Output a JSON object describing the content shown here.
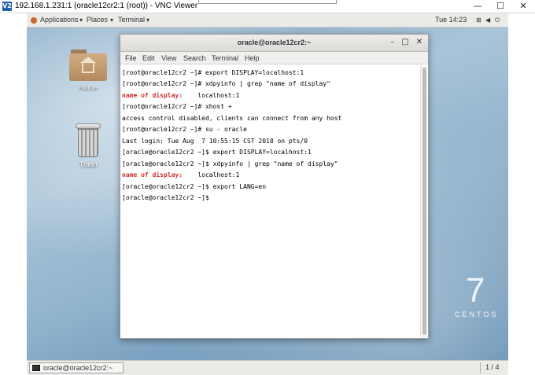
{
  "vnc": {
    "logo": "V2",
    "title": "192.168.1.231:1 (oracle12cr2:1 (root)) - VNC Viewer",
    "controls": {
      "minimize": "—",
      "maximize": "☐",
      "close": "✕"
    }
  },
  "topbar": {
    "applications": "Applications",
    "places": "Places",
    "terminal": "Terminal",
    "clock": "Tue 14:23"
  },
  "desktop": {
    "home_label": "Home",
    "trash_label": "Trash",
    "watermark_number": "7",
    "watermark_word": "CENTOS"
  },
  "terminal": {
    "title": "oracle@oracle12cr2:~",
    "controls": {
      "minimize": "–",
      "maximize": "□",
      "close": "✕"
    },
    "menu": [
      "File",
      "Edit",
      "View",
      "Search",
      "Terminal",
      "Help"
    ],
    "lines": [
      {
        "text": "[root@oracle12cr2 ~]# export DISPLAY=localhost:1"
      },
      {
        "text": "[root@oracle12cr2 ~]# xdpyinfo | grep \"name of display\""
      },
      {
        "red": "name of display:",
        "text": "    localhost:1"
      },
      {
        "text": "[root@oracle12cr2 ~]# xhost +"
      },
      {
        "text": "access control disabled, clients can connect from any host"
      },
      {
        "text": "[root@oracle12cr2 ~]# su - oracle"
      },
      {
        "text": "Last login: Tue Aug  7 10:55:15 CST 2018 on pts/0"
      },
      {
        "text": "[oracle@oracle12cr2 ~]$ export DISPLAY=localhost:1"
      },
      {
        "text": "[oracle@oracle12cr2 ~]$ xdpyinfo | grep \"name of display\""
      },
      {
        "red": "name of display:",
        "text": "    localhost:1"
      },
      {
        "text": "[oracle@oracle12cr2 ~]$ export LANG=en"
      },
      {
        "text": "[oracle@oracle12cr2 ~]$ "
      }
    ]
  },
  "taskbar": {
    "window_label": "oracle@oracle12cr2:~",
    "pager": "1 / 4"
  }
}
